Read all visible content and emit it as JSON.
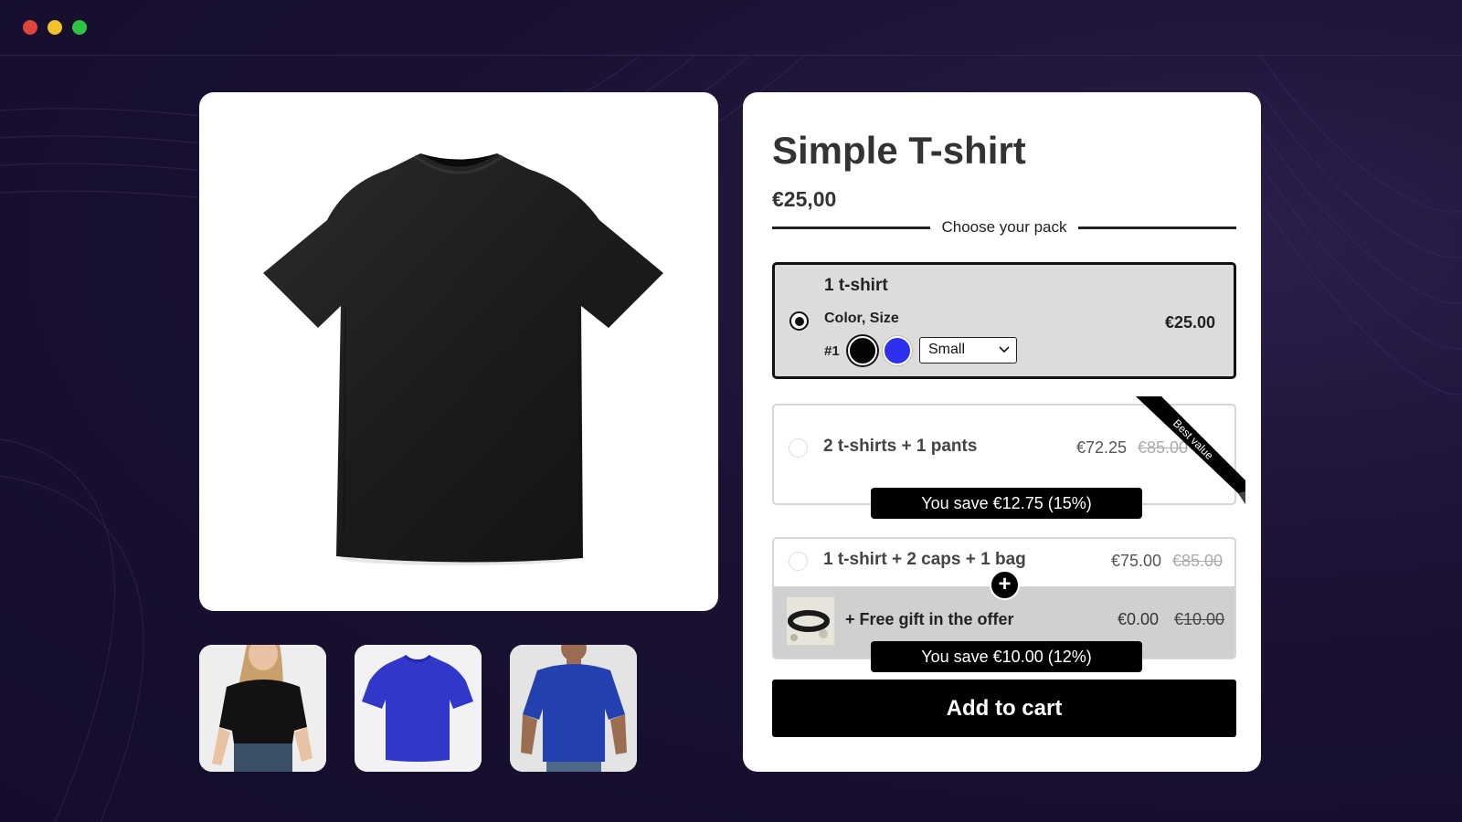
{
  "window": {
    "controls": [
      "close",
      "minimize",
      "maximize"
    ]
  },
  "gallery": {
    "main_image": "black t-shirt",
    "thumbnails": [
      "woman in black t-shirt",
      "blue t-shirt",
      "man in blue t-shirt"
    ]
  },
  "product": {
    "title": "Simple T-shirt",
    "price": "€25,00",
    "pack_divider_label": "Choose your pack"
  },
  "packs": [
    {
      "title": "1 t-shirt",
      "selected": true,
      "variant_label": "Color, Size",
      "item_number": "#1",
      "colors": [
        "#050505",
        "#2f2ff0"
      ],
      "size_value": "Small",
      "price": "€25.00"
    },
    {
      "title": "2 t-shirts + 1 pants",
      "selected": false,
      "price": "€72.25",
      "compare_price": "€85.00",
      "ribbon": "Best value",
      "savings": "You save €12.75 (15%)"
    },
    {
      "title": "1 t-shirt + 2 caps + 1 bag",
      "selected": false,
      "price": "€75.00",
      "compare_price": "€85.00",
      "gift": {
        "plus_symbol": "+",
        "label": "+ Free gift in the offer",
        "price": "€0.00",
        "compare_price": "€10.00"
      },
      "savings": "You save €10.00 (12%)"
    }
  ],
  "cart": {
    "add_label": "Add to cart"
  },
  "colors": {
    "background": "#1a1133",
    "accent": "#000000",
    "selected_pack_bg": "#dcdcdc"
  }
}
